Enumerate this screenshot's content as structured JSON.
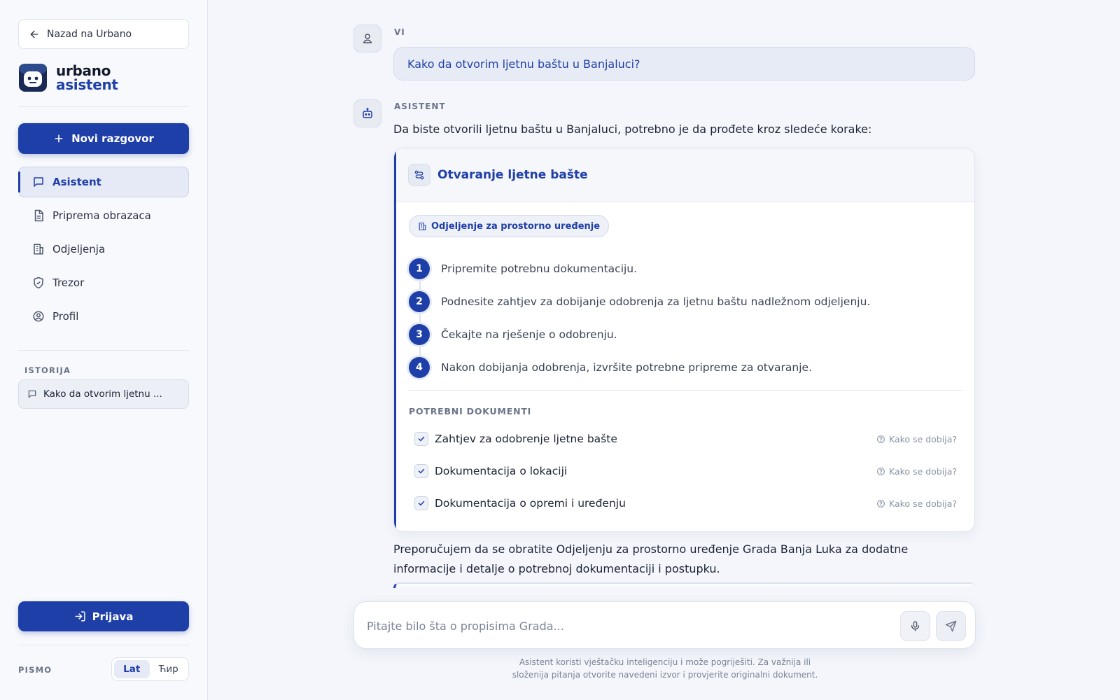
{
  "sidebar": {
    "back_label": "Nazad na Urbano",
    "brand_line1": "urbano",
    "brand_line2": "asistent",
    "new_chat_label": "Novi razgovor",
    "nav": [
      {
        "label": "Asistent",
        "icon": "chat-icon",
        "active": true
      },
      {
        "label": "Priprema obrazaca",
        "icon": "document-icon",
        "active": false
      },
      {
        "label": "Odjeljenja",
        "icon": "building-icon",
        "active": false
      },
      {
        "label": "Trezor",
        "icon": "shield-icon",
        "active": false
      },
      {
        "label": "Profil",
        "icon": "user-circle-icon",
        "active": false
      }
    ],
    "history_label": "ISTORIJA",
    "history_items": [
      "Kako da otvorim ljetnu ..."
    ],
    "login_label": "Prijava",
    "script_label": "PISMO",
    "script_options": [
      "Lat",
      "Ћир"
    ],
    "script_active": "Lat"
  },
  "chat": {
    "user_role": "VI",
    "user_message": "Kako da otvorim ljetnu baštu u Banjaluci?",
    "assistant_role": "ASISTENT",
    "assistant_intro": "Da biste otvorili ljetnu baštu u Banjaluci, potrebno je da prođete kroz sledeće korake:",
    "card": {
      "title": "Otvaranje ljetne bašte",
      "department": "Odjeljenje za prostorno uređenje",
      "steps": [
        {
          "num": "1",
          "text": "Pripremite potrebnu dokumentaciju."
        },
        {
          "num": "2",
          "text": "Podnesite zahtjev za dobijanje odobrenja za ljetnu baštu nadležnom odjeljenju."
        },
        {
          "num": "3",
          "text": "Čekajte na rješenje o odobrenju."
        },
        {
          "num": "4",
          "text": "Nakon dobijanja odobrenja, izvršite potrebne pripreme za otvaranje."
        }
      ],
      "docs_label": "POTREBNI DOKUMENTI",
      "docs": [
        {
          "name": "Zahtjev za odobrenje ljetne bašte",
          "help": "Kako se dobija?"
        },
        {
          "name": "Dokumentacija o lokaciji",
          "help": "Kako se dobija?"
        },
        {
          "name": "Dokumentacija o opremi i uređenju",
          "help": "Kako se dobija?"
        }
      ]
    },
    "assistant_outro": "Preporučujem da se obratite Odjeljenju za prostorno uređenje Grada Banja Luka za dodatne informacije i detalje o potrebnoj dokumentaciji i postupku."
  },
  "composer": {
    "placeholder": "Pitajte bilo šta o propisima Grada...",
    "value": ""
  },
  "disclaimer": "Asistent koristi vještačku inteligenciju i može pogriješiti. Za važnija ili složenija pitanja otvorite navedeni izvor i provjerite originalni dokument.",
  "colors": {
    "accent": "#1f3fa8",
    "background": "#f4f6fb",
    "sidebar": "#f8f9fc"
  }
}
